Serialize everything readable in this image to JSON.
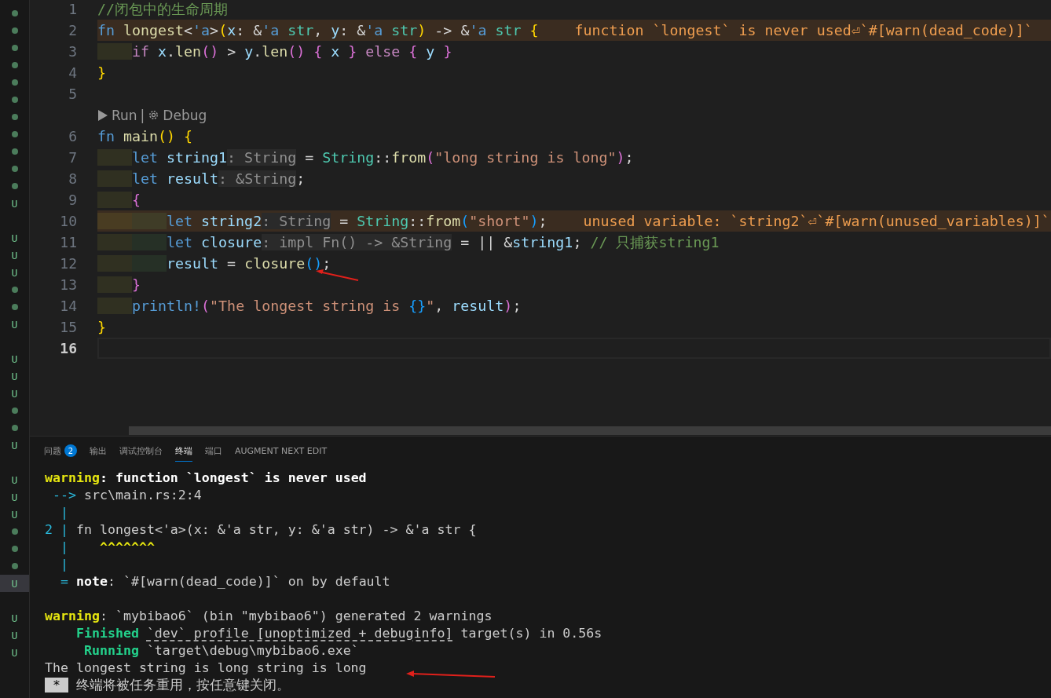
{
  "explorer_markers": [
    {
      "kind": "dot",
      "selected": false
    },
    {
      "kind": "dot",
      "selected": false
    },
    {
      "kind": "dot",
      "selected": false
    },
    {
      "kind": "dot",
      "selected": false
    },
    {
      "kind": "dot",
      "selected": false
    },
    {
      "kind": "dot",
      "selected": false
    },
    {
      "kind": "dot",
      "selected": false
    },
    {
      "kind": "dot",
      "selected": false
    },
    {
      "kind": "dot",
      "selected": false
    },
    {
      "kind": "dot",
      "selected": false
    },
    {
      "kind": "dot",
      "selected": false
    },
    {
      "kind": "letter",
      "text": "U",
      "selected": false
    },
    {
      "kind": "blank",
      "selected": false
    },
    {
      "kind": "letter",
      "text": "U",
      "selected": false
    },
    {
      "kind": "letter",
      "text": "U",
      "selected": false
    },
    {
      "kind": "letter",
      "text": "U",
      "selected": false
    },
    {
      "kind": "dot",
      "selected": false
    },
    {
      "kind": "dot",
      "selected": false
    },
    {
      "kind": "letter",
      "text": "U",
      "selected": false
    },
    {
      "kind": "blank",
      "selected": false
    },
    {
      "kind": "letter",
      "text": "U",
      "selected": false
    },
    {
      "kind": "letter",
      "text": "U",
      "selected": false
    },
    {
      "kind": "letter",
      "text": "U",
      "selected": false
    },
    {
      "kind": "dot",
      "selected": false
    },
    {
      "kind": "dot",
      "selected": false
    },
    {
      "kind": "letter",
      "text": "U",
      "selected": false
    },
    {
      "kind": "blank",
      "selected": false
    },
    {
      "kind": "letter",
      "text": "U",
      "selected": false
    },
    {
      "kind": "letter",
      "text": "U",
      "selected": false
    },
    {
      "kind": "letter",
      "text": "U",
      "selected": false
    },
    {
      "kind": "dot",
      "selected": false
    },
    {
      "kind": "dot",
      "selected": false
    },
    {
      "kind": "dot",
      "selected": false
    },
    {
      "kind": "letter",
      "text": "U",
      "selected": true
    },
    {
      "kind": "blank",
      "selected": false
    },
    {
      "kind": "letter",
      "text": "U",
      "selected": false
    },
    {
      "kind": "letter",
      "text": "U",
      "selected": false
    },
    {
      "kind": "letter",
      "text": "U",
      "selected": false
    }
  ],
  "editor": {
    "lines": [
      {
        "number": "1",
        "current": false,
        "tokens": [
          {
            "text": "//闭包中的生命周期",
            "kind": "comment"
          }
        ]
      },
      {
        "number": "2",
        "current": false,
        "tokens": [
          {
            "text": "fn ",
            "kind": "keyword"
          },
          {
            "text": "longest",
            "kind": "function"
          },
          {
            "text": "<",
            "kind": "punct"
          },
          {
            "text": "'a",
            "kind": "keyword"
          },
          {
            "text": ">",
            "kind": "punct"
          },
          {
            "text": "(",
            "kind": "bracket1"
          },
          {
            "text": "x",
            "kind": "variable"
          },
          {
            "text": ": &",
            "kind": "punct"
          },
          {
            "text": "'a",
            "kind": "keyword"
          },
          {
            "text": " str",
            "kind": "type"
          },
          {
            "text": ", ",
            "kind": "punct"
          },
          {
            "text": "y",
            "kind": "variable"
          },
          {
            "text": ": &",
            "kind": "punct"
          },
          {
            "text": "'a",
            "kind": "keyword"
          },
          {
            "text": " str",
            "kind": "type"
          },
          {
            "text": ")",
            "kind": "bracket1"
          },
          {
            "text": " -> &",
            "kind": "punct"
          },
          {
            "text": "'a",
            "kind": "keyword"
          },
          {
            "text": " str",
            "kind": "type"
          },
          {
            "text": " {",
            "kind": "bracket1"
          }
        ],
        "warning": "function `longest` is never used⏎`#[warn(dead_code)]`"
      },
      {
        "number": "3",
        "current": false,
        "tokens": [
          {
            "text": "    if ",
            "kind": "control"
          },
          {
            "text": "x",
            "kind": "variable"
          },
          {
            "text": ".",
            "kind": "punct"
          },
          {
            "text": "len",
            "kind": "function"
          },
          {
            "text": "()",
            "kind": "bracket2"
          },
          {
            "text": " > ",
            "kind": "punct"
          },
          {
            "text": "y",
            "kind": "variable"
          },
          {
            "text": ".",
            "kind": "punct"
          },
          {
            "text": "len",
            "kind": "function"
          },
          {
            "text": "()",
            "kind": "bracket2"
          },
          {
            "text": " {",
            "kind": "bracket2"
          },
          {
            "text": " x ",
            "kind": "variable"
          },
          {
            "text": "}",
            "kind": "bracket2"
          },
          {
            "text": " else",
            "kind": "control"
          },
          {
            "text": " {",
            "kind": "bracket2"
          },
          {
            "text": " y ",
            "kind": "variable"
          },
          {
            "text": "}",
            "kind": "bracket2"
          }
        ]
      },
      {
        "number": "4",
        "current": false,
        "tokens": [
          {
            "text": "}",
            "kind": "bracket1"
          }
        ]
      },
      {
        "number": "5",
        "current": false
      },
      {
        "codelens": {
          "run": "Run",
          "separator": "|",
          "debug": "Debug"
        }
      },
      {
        "number": "6",
        "current": false,
        "tokens": [
          {
            "text": "fn ",
            "kind": "keyword"
          },
          {
            "text": "main",
            "kind": "function"
          },
          {
            "text": "()",
            "kind": "bracket1"
          },
          {
            "text": " {",
            "kind": "bracket1"
          }
        ]
      },
      {
        "number": "7",
        "current": false,
        "tokens": [
          {
            "text": "    let ",
            "kind": "keyword"
          },
          {
            "text": "string1",
            "kind": "variable"
          },
          {
            "text": ": String",
            "kind": "hint"
          },
          {
            "text": " = ",
            "kind": "punct"
          },
          {
            "text": "String",
            "kind": "type"
          },
          {
            "text": "::",
            "kind": "punct"
          },
          {
            "text": "from",
            "kind": "function"
          },
          {
            "text": "(",
            "kind": "bracket2"
          },
          {
            "text": "\"long string is long\"",
            "kind": "string"
          },
          {
            "text": ")",
            "kind": "bracket2"
          },
          {
            "text": ";",
            "kind": "punct"
          }
        ]
      },
      {
        "number": "8",
        "current": false,
        "tokens": [
          {
            "text": "    let ",
            "kind": "keyword"
          },
          {
            "text": "result",
            "kind": "variable"
          },
          {
            "text": ": &String",
            "kind": "hint"
          },
          {
            "text": ";",
            "kind": "punct"
          }
        ]
      },
      {
        "number": "9",
        "current": false,
        "tokens": [
          {
            "text": "    {",
            "kind": "bracket2"
          }
        ]
      },
      {
        "number": "10",
        "current": false,
        "tokens": [
          {
            "text": "        let ",
            "kind": "keyword"
          },
          {
            "text": "string2",
            "kind": "variable"
          },
          {
            "text": ": String",
            "kind": "hint"
          },
          {
            "text": " = ",
            "kind": "punct"
          },
          {
            "text": "String",
            "kind": "type"
          },
          {
            "text": "::",
            "kind": "punct"
          },
          {
            "text": "from",
            "kind": "function"
          },
          {
            "text": "(",
            "kind": "bracket3"
          },
          {
            "text": "\"short\"",
            "kind": "string"
          },
          {
            "text": ")",
            "kind": "bracket3"
          },
          {
            "text": ";",
            "kind": "punct"
          }
        ],
        "warning": "unused variable: `string2`⏎`#[warn(unused_variables)]`"
      },
      {
        "number": "11",
        "current": false,
        "tokens": [
          {
            "text": "        let ",
            "kind": "keyword"
          },
          {
            "text": "closure",
            "kind": "variable"
          },
          {
            "text": ": impl Fn() -> &String",
            "kind": "hint"
          },
          {
            "text": " = || &",
            "kind": "punct"
          },
          {
            "text": "string1",
            "kind": "variable"
          },
          {
            "text": "; ",
            "kind": "punct"
          },
          {
            "text": "// 只捕获string1",
            "kind": "comment"
          }
        ]
      },
      {
        "number": "12",
        "current": false,
        "tokens": [
          {
            "text": "        result",
            "kind": "variable"
          },
          {
            "text": " = ",
            "kind": "punct"
          },
          {
            "text": "closure",
            "kind": "function"
          },
          {
            "text": "()",
            "kind": "bracket3"
          },
          {
            "text": ";",
            "kind": "punct"
          }
        ]
      },
      {
        "number": "13",
        "current": false,
        "tokens": [
          {
            "text": "    }",
            "kind": "bracket2"
          }
        ]
      },
      {
        "number": "14",
        "current": false,
        "tokens": [
          {
            "text": "    println!",
            "kind": "keyword"
          },
          {
            "text": "(",
            "kind": "bracket2"
          },
          {
            "text": "\"The longest string is ",
            "kind": "string"
          },
          {
            "text": "{}",
            "kind": "bracket3"
          },
          {
            "text": "\"",
            "kind": "string"
          },
          {
            "text": ", ",
            "kind": "punct"
          },
          {
            "text": "result",
            "kind": "variable"
          },
          {
            "text": ")",
            "kind": "bracket2"
          },
          {
            "text": ";",
            "kind": "punct"
          }
        ]
      },
      {
        "number": "15",
        "current": false,
        "tokens": [
          {
            "text": "}",
            "kind": "bracket1"
          }
        ]
      },
      {
        "number": "16",
        "current": true
      }
    ]
  },
  "panel": {
    "tabs": [
      {
        "label": "问题",
        "badge": "2",
        "selected": false
      },
      {
        "label": "输出",
        "selected": false
      },
      {
        "label": "调试控制台",
        "selected": false
      },
      {
        "label": "终端",
        "selected": true
      },
      {
        "label": "端口",
        "selected": false
      },
      {
        "label": "AUGMENT NEXT EDIT",
        "selected": false
      }
    ],
    "terminal": [
      {
        "lines": [
          {
            "tokens": [
              {
                "text": "warning",
                "kind": "warn"
              },
              {
                "text": ": function `longest` is never used",
                "kind": "bold"
              }
            ]
          },
          {
            "tokens": [
              {
                "text": " -->",
                "kind": "cyan"
              },
              {
                "text": " src\\main.rs:2:4",
                "kind": "plain"
              }
            ]
          },
          {
            "tokens": [
              {
                "text": "  |",
                "kind": "cyan"
              }
            ]
          },
          {
            "tokens": [
              {
                "text": "2 |",
                "kind": "cyan"
              },
              {
                "text": " fn longest<'a>(x: &'a str, y: &'a str) -> &'a str {",
                "kind": "plain"
              }
            ]
          },
          {
            "tokens": [
              {
                "text": "  |",
                "kind": "cyan"
              },
              {
                "text": "    ^^^^^^^",
                "kind": "caret"
              }
            ]
          },
          {
            "tokens": [
              {
                "text": "  |",
                "kind": "cyan"
              }
            ]
          },
          {
            "tokens": [
              {
                "text": "  = ",
                "kind": "cyan"
              },
              {
                "text": "note",
                "kind": "bold"
              },
              {
                "text": ": `#[warn(dead_code)]` on by default",
                "kind": "plain"
              }
            ]
          }
        ]
      },
      {
        "lines": [
          {
            "tokens": [
              {
                "text": "warning",
                "kind": "warn"
              },
              {
                "text": ": `mybibao6` (bin \"mybibao6\") generated 2 warnings",
                "kind": "plain"
              }
            ]
          },
          {
            "tokens": [
              {
                "text": "    Finished ",
                "kind": "green"
              },
              {
                "text": "`dev` profile [unoptimized + debuginfo]",
                "kind": "link"
              },
              {
                "text": " target(s) in 0.56s",
                "kind": "plain"
              }
            ]
          },
          {
            "tokens": [
              {
                "text": "     Running",
                "kind": "green"
              },
              {
                "text": " `target\\debug\\mybibao6.exe`",
                "kind": "plain"
              }
            ]
          },
          {
            "tokens": [
              {
                "text": "The longest string is long string is long",
                "kind": "plain"
              }
            ]
          },
          {
            "tokens": [
              {
                "text": " * ",
                "kind": "inverse"
              },
              {
                "text": " 终端将被任务重用，按任意键关闭。",
                "kind": "plain"
              }
            ]
          }
        ]
      }
    ]
  }
}
